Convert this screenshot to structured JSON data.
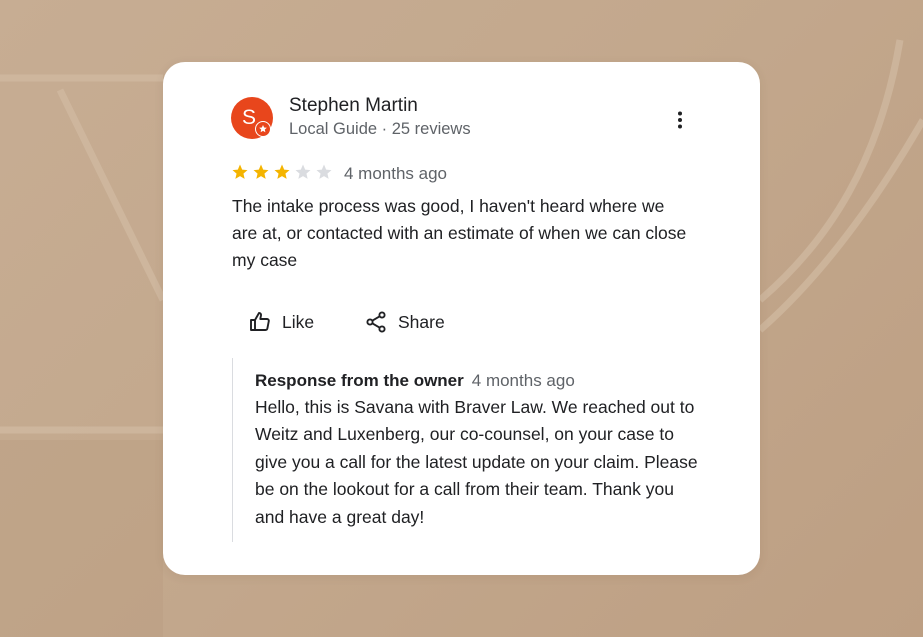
{
  "review": {
    "author": {
      "avatar_letter": "S",
      "name": "Stephen Martin",
      "meta": "Local Guide · 25 reviews"
    },
    "rating": 3,
    "rating_max": 5,
    "time": "4 months ago",
    "text": "The intake process was good, I haven't heard where we are at, or contacted with an estimate of when we can close my case",
    "actions": {
      "like_label": "Like",
      "share_label": "Share"
    },
    "owner_response": {
      "title": "Response from the owner",
      "time": "4 months ago",
      "text": "Hello, this is Savana with Braver Law. We reached out to Weitz and Luxenberg, our co-counsel, on your case to give you a call for the latest update on your claim. Please be on the lookout for a call from their team. Thank you and have a great day!"
    }
  },
  "colors": {
    "avatar": "#e8461c",
    "star_filled": "#f4b400",
    "star_empty": "#dadce0",
    "background": "#c3a88d"
  },
  "icons": {
    "more": "more-vert-icon",
    "like": "thumb-up-outline-icon",
    "share": "share-icon",
    "badge": "local-guide-star-icon"
  }
}
